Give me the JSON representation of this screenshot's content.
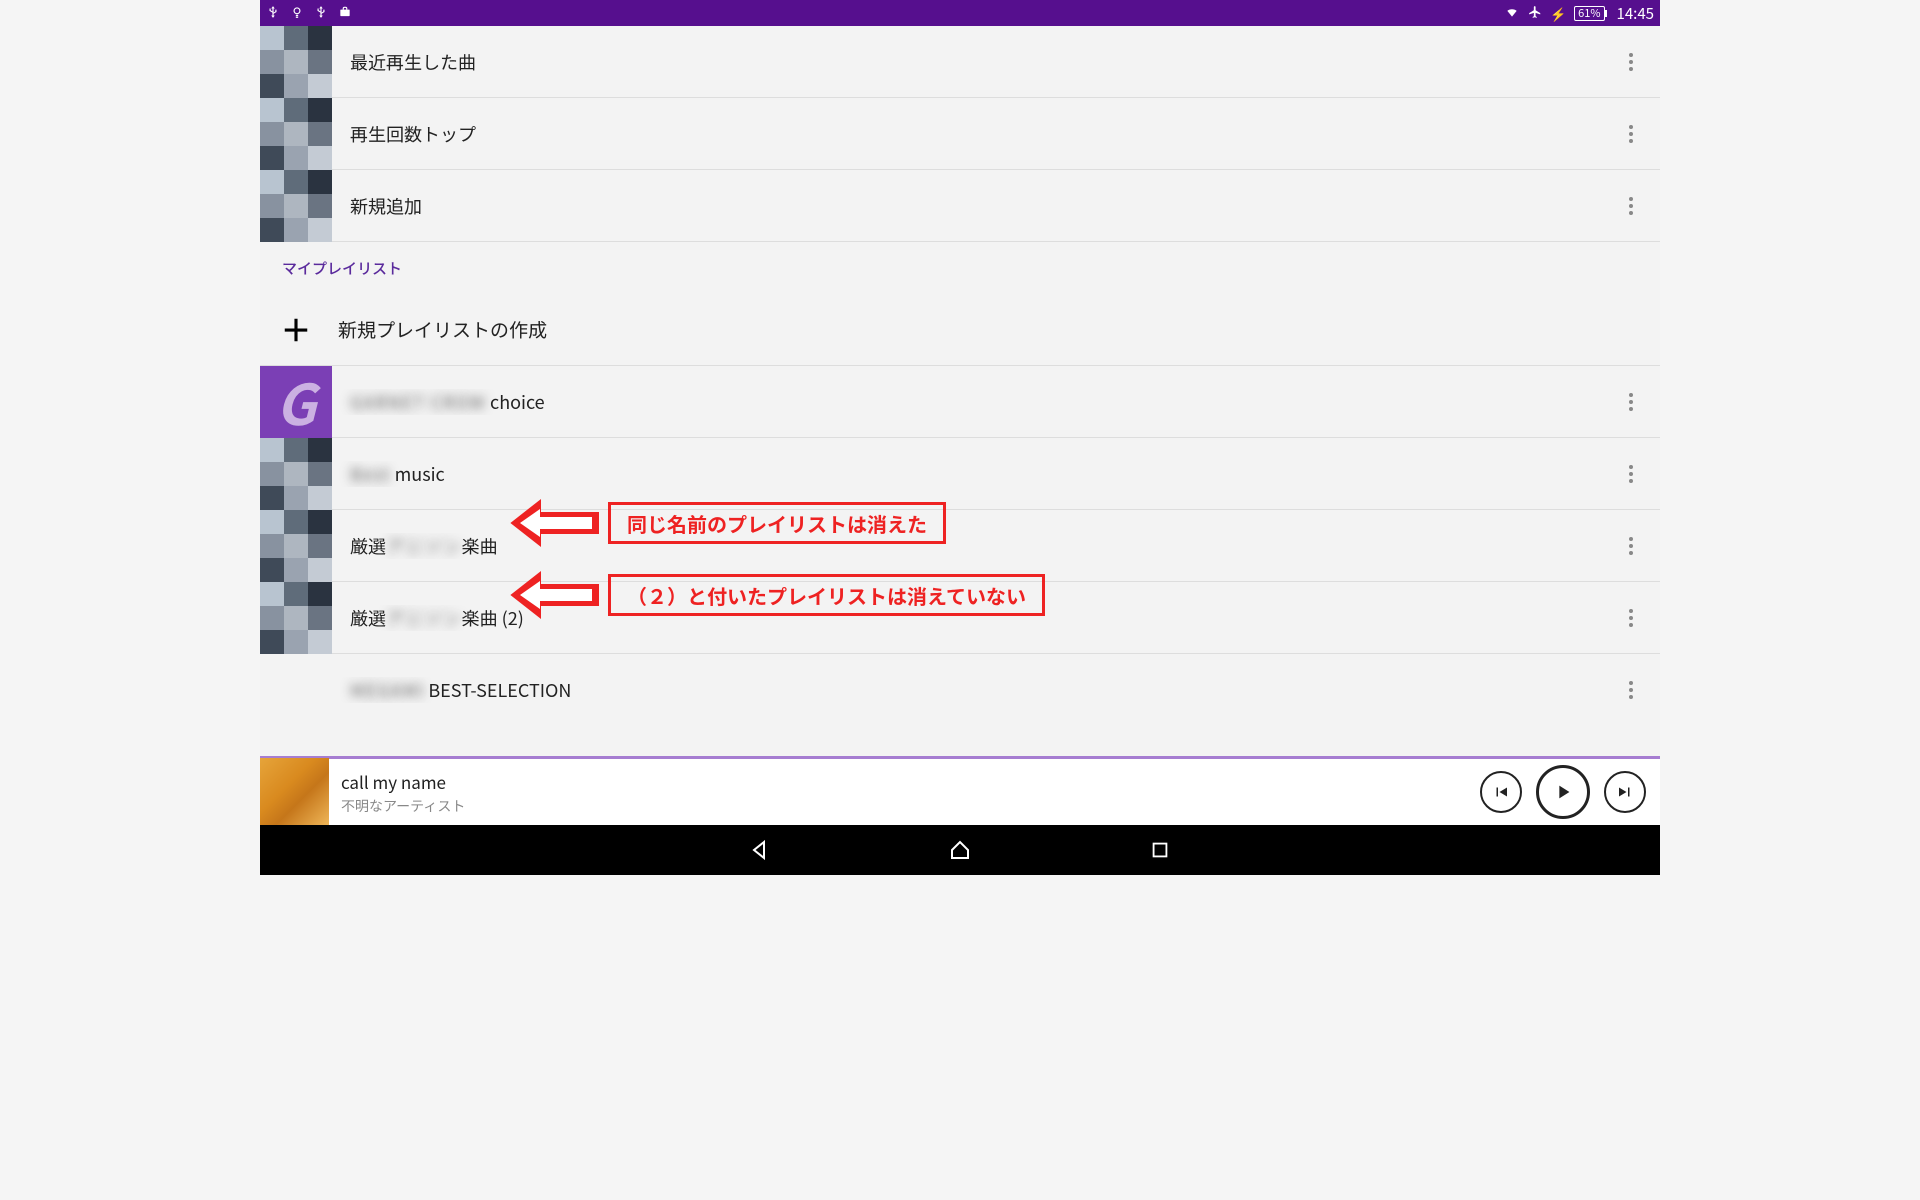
{
  "statusbar": {
    "battery_pct": "61%",
    "time": "14:45"
  },
  "auto_playlists": [
    {
      "label": "最近再生した曲"
    },
    {
      "label": "再生回数トップ"
    },
    {
      "label": "新規追加"
    }
  ],
  "section_header": "マイプレイリスト",
  "create_label": "新規プレイリストの作成",
  "my_playlists": [
    {
      "blur_prefix": "GARNET CROW",
      "label_suffix": " choice",
      "thumb": "purple"
    },
    {
      "blur_prefix": "Best",
      "label_suffix": " music",
      "thumb": "mosaic"
    },
    {
      "blur_prefix": "厳選",
      "blur_mid": "アニソン",
      "label_suffix": "楽曲",
      "thumb": "mosaic"
    },
    {
      "blur_prefix": "厳選",
      "blur_mid": "アニソン",
      "label_suffix": "楽曲 (2)",
      "thumb": "mosaic"
    },
    {
      "blur_prefix": "MEGAMI",
      "label_suffix": " BEST-SELECTION",
      "thumb": "none"
    }
  ],
  "now_playing": {
    "title": "call my name",
    "artist": "不明なアーティスト"
  },
  "annotations": [
    {
      "text": "同じ名前のプレイリストは消えた"
    },
    {
      "text": "（２）と付いたプレイリストは消えていない"
    }
  ]
}
